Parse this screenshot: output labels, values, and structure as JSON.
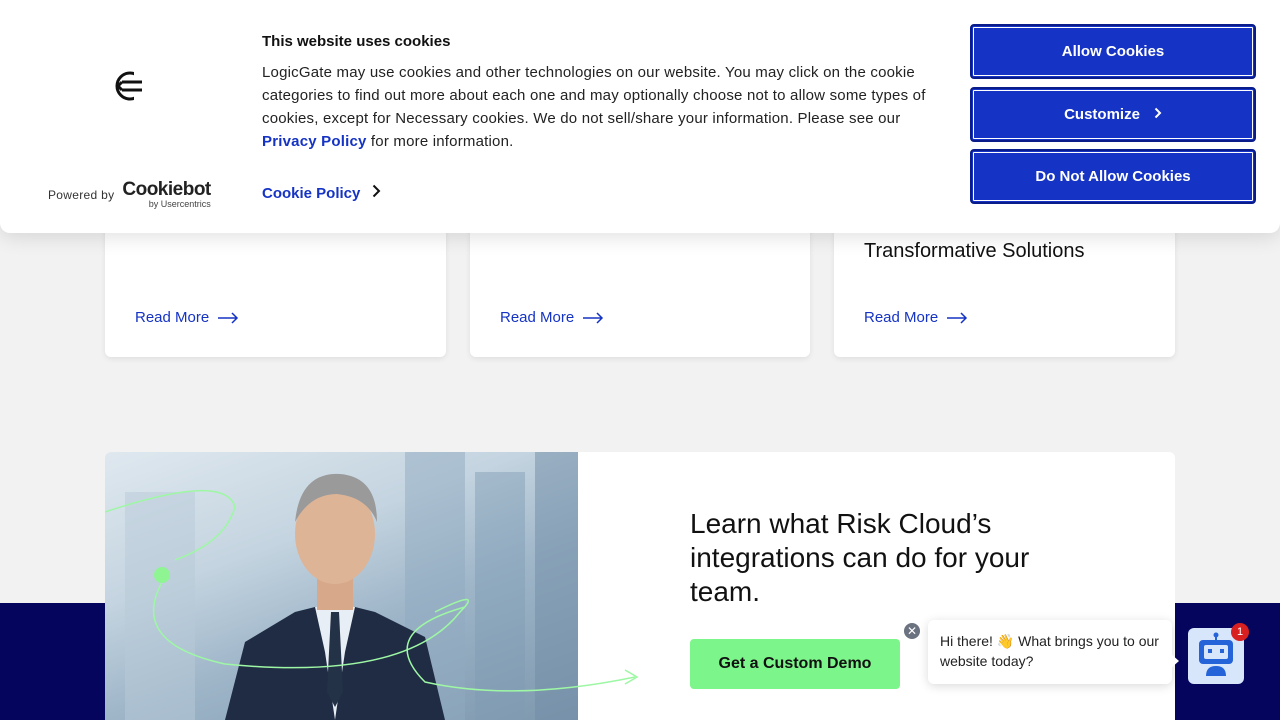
{
  "cookie_banner": {
    "title": "This website uses cookies",
    "text_part1": "LogicGate may use cookies and other technologies on our website. You may click on the cookie categories to find out more about each one and may optionally choose not to allow some types of cookies, except for Necessary cookies.  We do not sell/share your information. Please see our ",
    "privacy_link": "Privacy Policy",
    "text_part2": " for more information.",
    "cookie_policy": "Cookie Policy",
    "powered_by": "Powered by",
    "brand_name": "Cookiebot",
    "brand_sub": "by Usercentrics",
    "buttons": {
      "allow": "Allow Cookies",
      "customize": "Customize",
      "deny": "Do Not Allow Cookies"
    }
  },
  "cards": [
    {
      "title": "",
      "read_more": "Read More"
    },
    {
      "title": "",
      "read_more": "Read More"
    },
    {
      "title": "Transformative Solutions",
      "read_more": "Read More"
    }
  ],
  "promo": {
    "heading": "Learn what Risk Cloud’s integrations can do for your team.",
    "cta": "Get a Custom Demo"
  },
  "chat": {
    "message": "Hi there! 👋 What brings you to our website today?",
    "badge_count": "1",
    "close_glyph": "✕"
  },
  "colors": {
    "brand_blue": "#1533c4",
    "navy": "#05055e",
    "cta_green": "#7cf58a"
  }
}
